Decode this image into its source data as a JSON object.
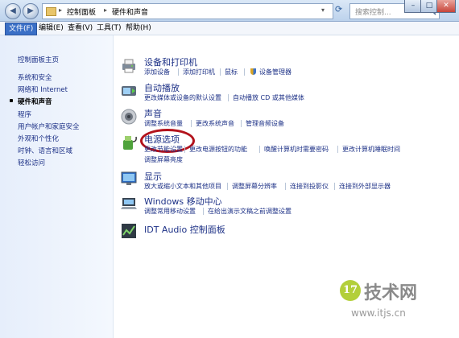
{
  "address_bar": {
    "crumbs": [
      "控制面板",
      "硬件和声音"
    ]
  },
  "search": {
    "placeholder": "搜索控制..."
  },
  "window_buttons": {
    "minimize": "–",
    "maximize": "□",
    "close": "✕"
  },
  "menu": [
    {
      "label": "文件(F)",
      "active": true
    },
    {
      "label": "编辑(E)"
    },
    {
      "label": "查看(V)"
    },
    {
      "label": "工具(T)"
    },
    {
      "label": "帮助(H)"
    }
  ],
  "sidebar": {
    "items": [
      {
        "label": "控制面板主页"
      },
      {
        "label": "系统和安全"
      },
      {
        "label": "网络和 Internet"
      },
      {
        "label": "硬件和声音",
        "current": true
      },
      {
        "label": "程序"
      },
      {
        "label": "用户帐户和家庭安全"
      },
      {
        "label": "外观和个性化"
      },
      {
        "label": "时钟、语言和区域"
      },
      {
        "label": "轻松访问"
      }
    ]
  },
  "categories": [
    {
      "title": "设备和打印机",
      "icon": "printer-icon",
      "links": [
        "添加设备",
        "添加打印机",
        "鼠标",
        "设备管理器"
      ]
    },
    {
      "title": "自动播放",
      "icon": "autoplay-icon",
      "links": [
        "更改媒体或设备的默认设置",
        "自动播放 CD 或其他媒体"
      ]
    },
    {
      "title": "声音",
      "icon": "speaker-icon",
      "links": [
        "调整系统音量",
        "更改系统声音",
        "管理音频设备"
      ]
    },
    {
      "title": "电源选项",
      "icon": "power-icon",
      "links": [
        "更改节能设置",
        "更改电源按钮的功能",
        "唤醒计算机时需要密码",
        "更改计算机睡眠时间",
        "调整屏幕亮度"
      ]
    },
    {
      "title": "显示",
      "icon": "display-icon",
      "links": [
        "放大或缩小文本和其他项目",
        "调整屏幕分辨率",
        "连接到投影仪",
        "连接到外部显示器"
      ]
    },
    {
      "title": "Windows 移动中心",
      "icon": "mobility-center-icon",
      "links": [
        "调整常用移动设置",
        "在给出演示文稿之前调整设置"
      ]
    },
    {
      "title": "IDT Audio 控制面板",
      "icon": "audio-panel-icon",
      "links": []
    }
  ],
  "watermark": {
    "logo": "17",
    "text": "技术网",
    "url": "www.itjs.cn"
  },
  "colors": {
    "link": "#1e3287",
    "highlight_circle": "#b3121b"
  }
}
